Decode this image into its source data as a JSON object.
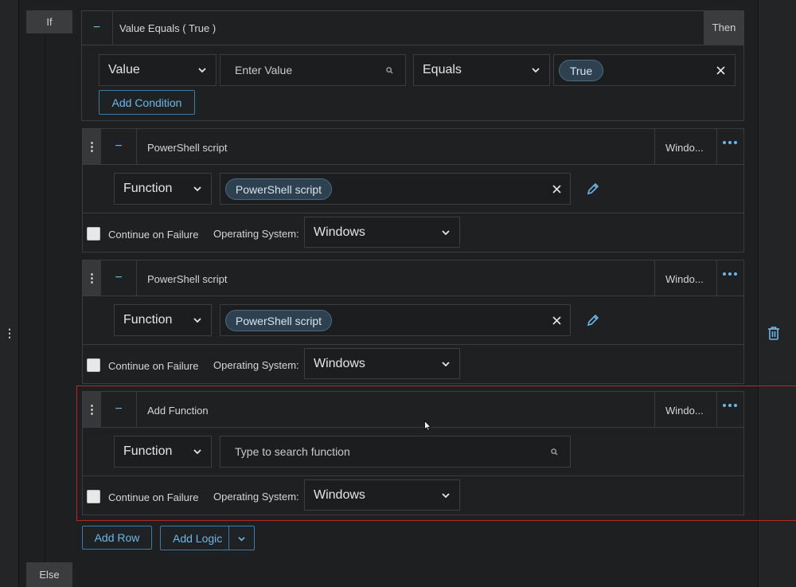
{
  "if_label": "If",
  "else_label": "Else",
  "then_label": "Then",
  "condition": {
    "title": "Value Equals ( True )",
    "field_select": "Value",
    "value_placeholder": "Enter Value",
    "operator_select": "Equals",
    "value_chip": "True",
    "add_condition_label": "Add Condition"
  },
  "rows": [
    {
      "title": "PowerShell script",
      "os_short": "Windo...",
      "type_select": "Function",
      "function_chip": "PowerShell script",
      "search_placeholder": "",
      "continue_label": "Continue on Failure",
      "os_label": "Operating System:",
      "os_select": "Windows"
    },
    {
      "title": "PowerShell script",
      "os_short": "Windo...",
      "type_select": "Function",
      "function_chip": "PowerShell script",
      "search_placeholder": "",
      "continue_label": "Continue on Failure",
      "os_label": "Operating System:",
      "os_select": "Windows"
    },
    {
      "title": "Add Function",
      "os_short": "Windo...",
      "type_select": "Function",
      "function_chip": "",
      "search_placeholder": "Type to search function",
      "continue_label": "Continue on Failure",
      "os_label": "Operating System:",
      "os_select": "Windows"
    }
  ],
  "footer": {
    "add_row_label": "Add Row",
    "add_logic_label": "Add Logic"
  },
  "colors": {
    "accent": "#6cb7e9",
    "chip_bg": "#2d4150",
    "selection_outline": "#b02a2a"
  },
  "icons": [
    "vertical-dots-icon",
    "minus-icon",
    "chevron-down-icon",
    "search-icon",
    "close-icon",
    "pencil-icon",
    "horizontal-dots-icon",
    "trash-icon",
    "mouse-cursor-icon"
  ]
}
